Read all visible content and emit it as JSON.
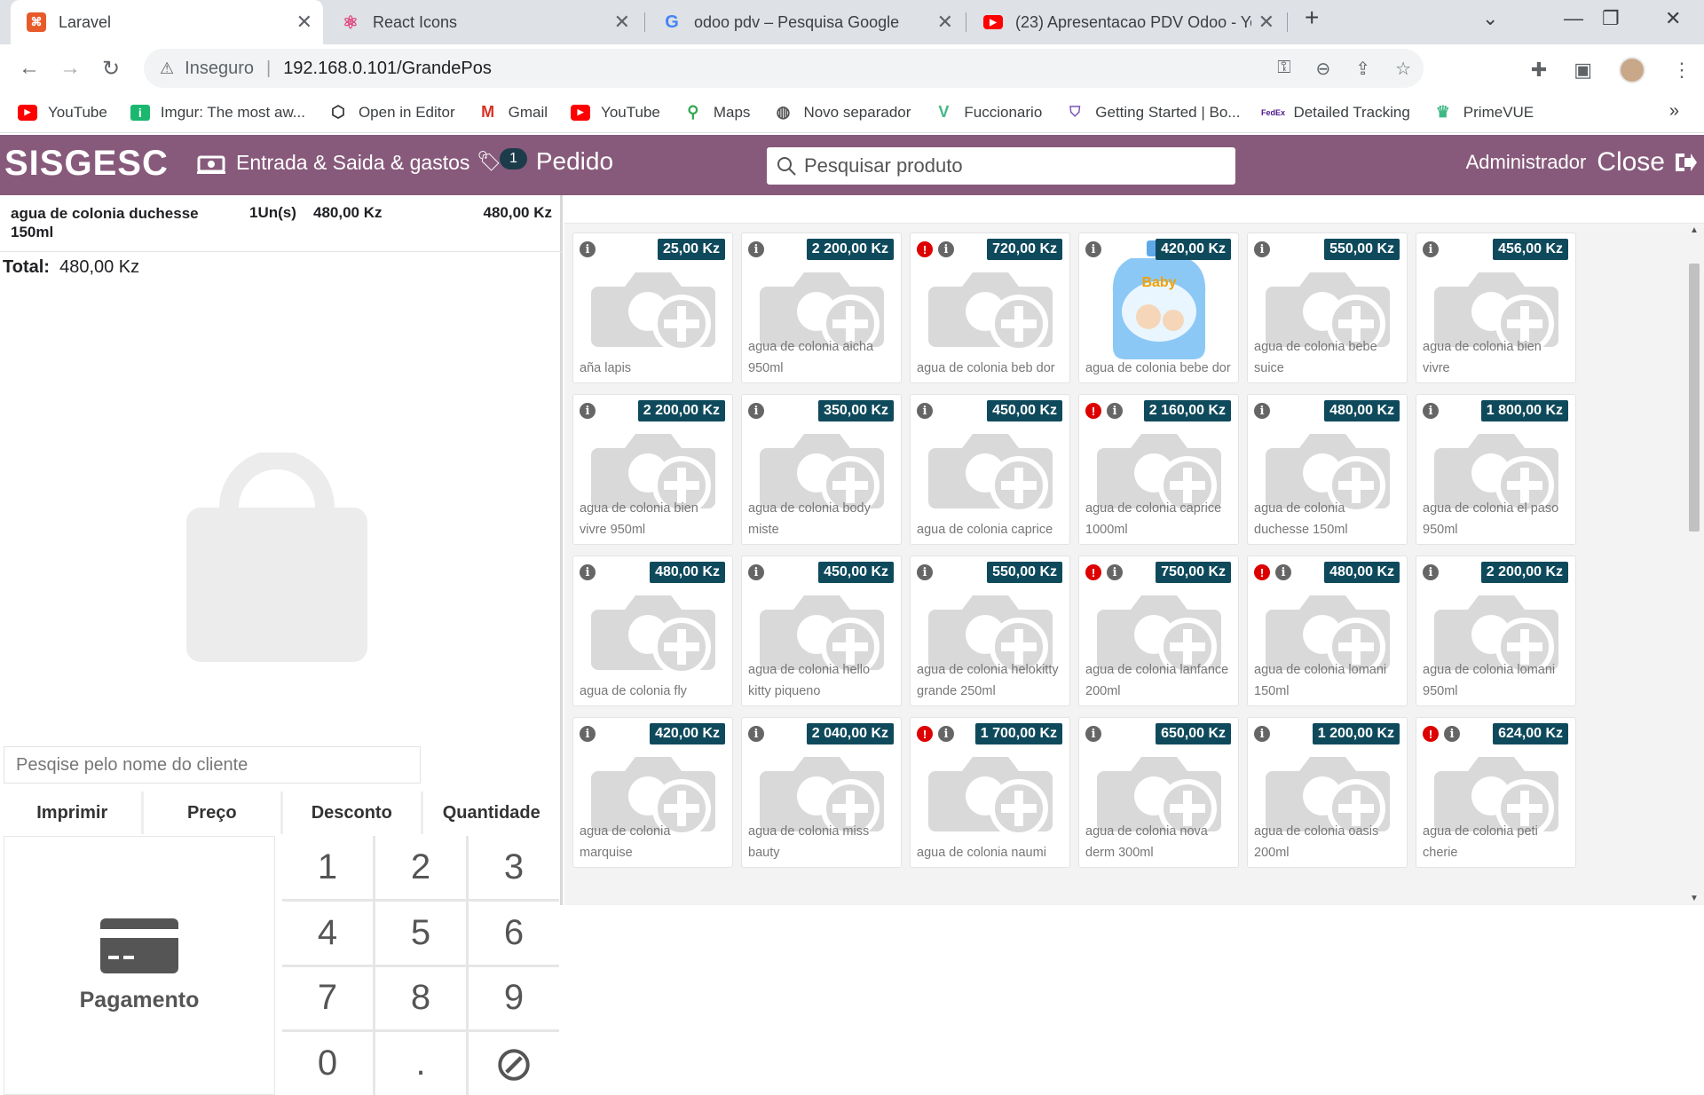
{
  "browser": {
    "tabs": [
      {
        "title": "Laravel",
        "icon": "laravel-icon",
        "active": true
      },
      {
        "title": "React Icons",
        "icon": "react-icon",
        "active": false
      },
      {
        "title": "odoo pdv – Pesquisa Google",
        "icon": "google-icon",
        "active": false
      },
      {
        "title": "(23) Apresentacao PDV Odoo - Yo",
        "icon": "youtube-icon",
        "active": false
      }
    ],
    "new_tab": "+",
    "security_label": "Inseguro",
    "url": "192.168.0.101/GrandePos",
    "bookmarks": [
      {
        "label": "YouTube",
        "icon": "youtube-icon"
      },
      {
        "label": "Imgur: The most aw...",
        "icon": "imgur-icon"
      },
      {
        "label": "Open in Editor",
        "icon": "editor-icon"
      },
      {
        "label": "Gmail",
        "icon": "gmail-icon"
      },
      {
        "label": "YouTube",
        "icon": "youtube-icon"
      },
      {
        "label": "Maps",
        "icon": "maps-icon"
      },
      {
        "label": "Novo separador",
        "icon": "globe-icon"
      },
      {
        "label": "Fuccionario",
        "icon": "vue-icon"
      },
      {
        "label": "Getting Started | Bo...",
        "icon": "bootstrap-icon"
      },
      {
        "label": "Detailed Tracking",
        "icon": "fedex-icon"
      },
      {
        "label": "PrimeVUE",
        "icon": "primevue-icon"
      }
    ],
    "more_bookmarks": "»"
  },
  "app": {
    "brand": "SISGESC",
    "nav_cash": "Entrada & Saida & gastos",
    "order_badge": "1",
    "nav_order": "Pedido",
    "search_placeholder": "Pesquisar produto",
    "user": "Administrador",
    "close_label": "Close",
    "accent_color": "#875a7b",
    "price_tag_color": "#0f4a5c"
  },
  "order": {
    "line": {
      "name": "agua de colonia duchesse 150ml",
      "qty": "1Un(s)",
      "unit_price": "480,00 Kz",
      "total": "480,00 Kz"
    },
    "total_label": "Total:",
    "total_value": "480,00 Kz",
    "client_placeholder": "Pesqise pelo nome do cliente",
    "modes": [
      "Imprimir",
      "Preço",
      "Desconto",
      "Quantidade"
    ],
    "payment_label": "Pagamento",
    "keys": [
      "1",
      "2",
      "3",
      "4",
      "5",
      "6",
      "7",
      "8",
      "9",
      "0",
      ".",
      "⊘"
    ]
  },
  "products": [
    {
      "name": "aña lapis",
      "price": "25,00 Kz",
      "warn": false
    },
    {
      "name": "agua de colonia aicha 950ml",
      "price": "2 200,00 Kz",
      "warn": false
    },
    {
      "name": "agua de colonia beb dor",
      "price": "720,00 Kz",
      "warn": true
    },
    {
      "name": "agua de colonia bebe dor",
      "price": "420,00 Kz",
      "warn": false,
      "has_image": true
    },
    {
      "name": "agua de colonia bebe suice",
      "price": "550,00 Kz",
      "warn": false
    },
    {
      "name": "agua de colonia bien vivre",
      "price": "456,00 Kz",
      "warn": false
    },
    {
      "name": "agua de colonia bien vivre 950ml",
      "price": "2 200,00 Kz",
      "warn": false
    },
    {
      "name": "agua de colonia body miste",
      "price": "350,00 Kz",
      "warn": false
    },
    {
      "name": "agua de colonia caprice",
      "price": "450,00 Kz",
      "warn": false
    },
    {
      "name": "agua de colonia caprice 1000ml",
      "price": "2 160,00 Kz",
      "warn": true
    },
    {
      "name": "agua de colonia duchesse 150ml",
      "price": "480,00 Kz",
      "warn": false
    },
    {
      "name": "agua de colonia el paso 950ml",
      "price": "1 800,00 Kz",
      "warn": false
    },
    {
      "name": "agua de colonia fly",
      "price": "480,00 Kz",
      "warn": false
    },
    {
      "name": "agua de colonia hello kitty piqueno",
      "price": "450,00 Kz",
      "warn": false
    },
    {
      "name": "agua de colonia helokitty grande 250ml",
      "price": "550,00 Kz",
      "warn": false
    },
    {
      "name": "agua de colonia lanfance 200ml",
      "price": "750,00 Kz",
      "warn": true
    },
    {
      "name": "agua de colonia lomani 150ml",
      "price": "480,00 Kz",
      "warn": true
    },
    {
      "name": "agua de colonia lomani 950ml",
      "price": "2 200,00 Kz",
      "warn": false
    },
    {
      "name": "agua de colonia marquise",
      "price": "420,00 Kz",
      "warn": false
    },
    {
      "name": "agua de colonia miss bauty",
      "price": "2 040,00 Kz",
      "warn": false
    },
    {
      "name": "agua de colonia naumi",
      "price": "1 700,00 Kz",
      "warn": true
    },
    {
      "name": "agua de colonia nova derm 300ml",
      "price": "650,00 Kz",
      "warn": false
    },
    {
      "name": "agua de colonia oasis 200ml",
      "price": "1 200,00 Kz",
      "warn": false
    },
    {
      "name": "agua de colonia peti cherie",
      "price": "624,00 Kz",
      "warn": true
    }
  ]
}
